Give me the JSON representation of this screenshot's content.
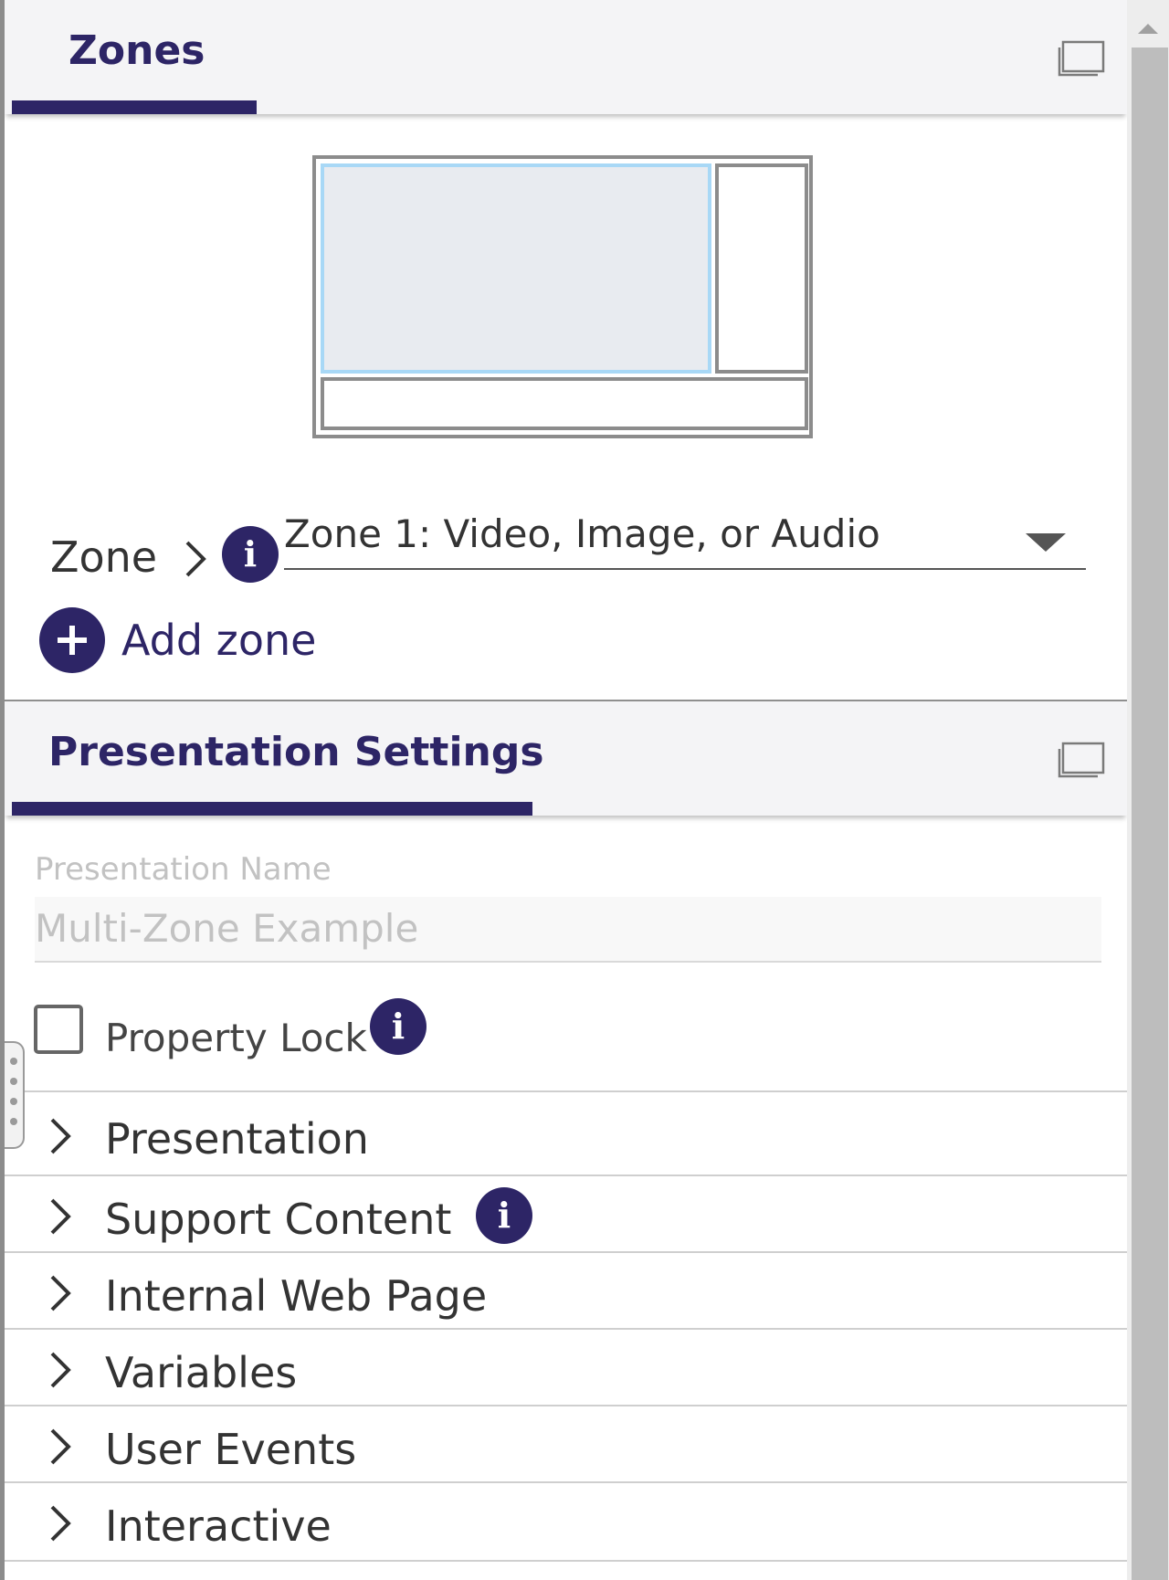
{
  "zones_section": {
    "title": "Zones",
    "icon": "window-icon"
  },
  "zone_selector": {
    "label": "Zone",
    "chevron_icon": "chevron-right-icon",
    "info_icon": "info-icon",
    "info_glyph": "i",
    "selected_value": "Zone 1: Video, Image, or Audio",
    "caret_icon": "chevron-down-icon"
  },
  "add_zone": {
    "label": "Add zone",
    "icon": "plus-circle-icon"
  },
  "presentation_section": {
    "title": "Presentation Settings",
    "icon": "window-icon"
  },
  "presentation_name": {
    "label": "Presentation Name",
    "value": "Multi-Zone Example"
  },
  "property_lock": {
    "label": "Property Lock",
    "checked": false,
    "info_glyph": "i"
  },
  "accordion": {
    "items": [
      {
        "label": "Presentation",
        "has_info": false
      },
      {
        "label": "Support Content",
        "has_info": true,
        "info_glyph": "i"
      },
      {
        "label": "Internal Web Page",
        "has_info": false
      },
      {
        "label": "Variables",
        "has_info": false
      },
      {
        "label": "User Events",
        "has_info": false
      },
      {
        "label": "Interactive",
        "has_info": false
      }
    ]
  },
  "colors": {
    "accent": "#2d2566",
    "selected_zone_border": "#a8d8f6",
    "selected_zone_fill": "#e8ebf0",
    "muted_text": "#c2c2c2",
    "header_bg": "#f4f4f6"
  }
}
